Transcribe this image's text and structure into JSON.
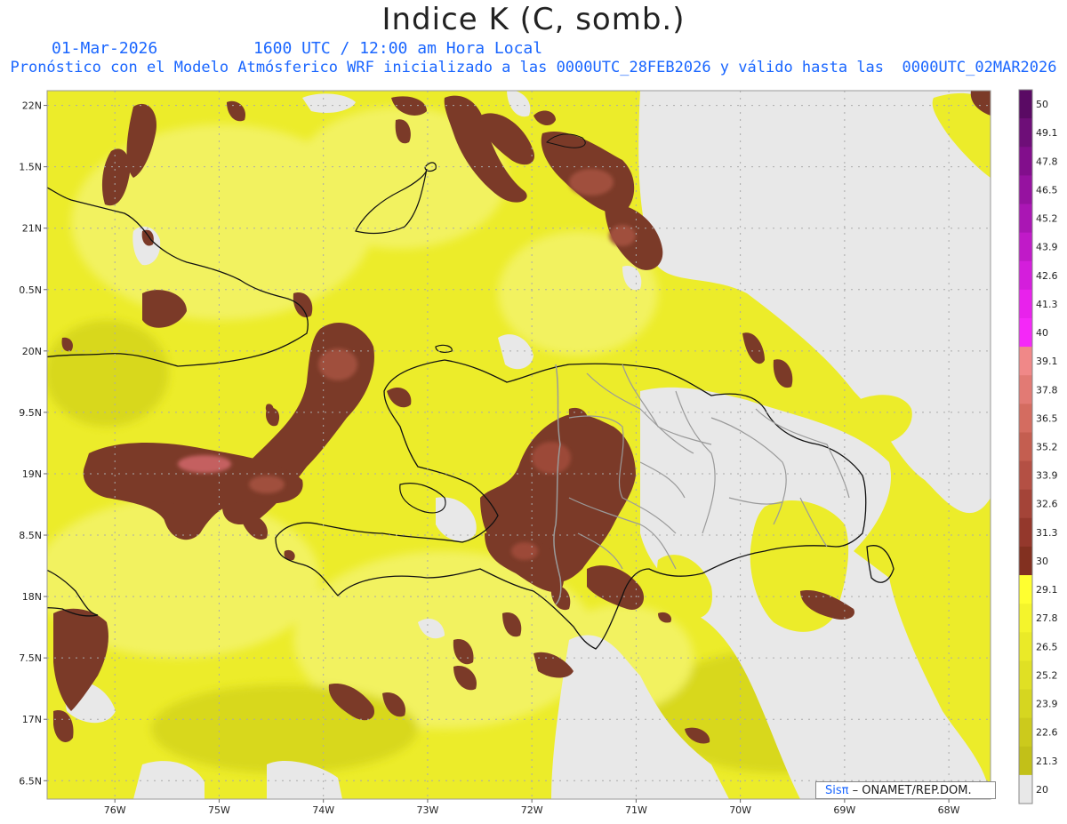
{
  "header": {
    "title": "Indice K (C, somb.)",
    "date": "01-Mar-2026",
    "time": "1600 UTC / 12:00 am Hora Local",
    "model_line": "Pronóstico con el Modelo Atmósferico WRF inicializado a las 0000UTC_28FEB2026 y válido hasta las  0000UTC_02MAR2026"
  },
  "map": {
    "lat_labels": [
      "22N",
      "1.5N",
      "21N",
      "0.5N",
      "20N",
      "9.5N",
      "19N",
      "8.5N",
      "18N",
      "7.5N",
      "17N",
      "6.5N"
    ],
    "lat_values": [
      22,
      21.5,
      21,
      20.5,
      20,
      19.5,
      19,
      18.5,
      18,
      17.5,
      17,
      16.5
    ],
    "lon_labels": [
      "76W",
      "75W",
      "74W",
      "73W",
      "72W",
      "71W",
      "70W",
      "69W",
      "68W"
    ],
    "lon_values": [
      -76,
      -75,
      -74,
      -73,
      -72,
      -71,
      -70,
      -69,
      -68
    ],
    "extent": {
      "lon_min": -76.65,
      "lon_max": -67.6,
      "lat_min": 16.35,
      "lat_max": 22.12
    },
    "colors": {
      "land_gray": "#e8e8e8",
      "yellow_light": "#f0f05a",
      "yellow": "#ecec2a",
      "yellow_dark": "#d4d418",
      "brown": "#7b3a28",
      "brown_light": "#9c4a38",
      "pink": "#d07070",
      "coast": "#111111",
      "border_gray": "#9a9a9a"
    }
  },
  "legend": {
    "labels": [
      "50",
      "49.1",
      "47.8",
      "46.5",
      "45.2",
      "43.9",
      "42.6",
      "41.3",
      "40",
      "39.1",
      "37.8",
      "36.5",
      "35.2",
      "33.9",
      "32.6",
      "31.3",
      "30",
      "29.1",
      "27.8",
      "26.5",
      "25.2",
      "23.9",
      "22.6",
      "21.3",
      "20"
    ],
    "colors": [
      "#5a0a64",
      "#6e0e78",
      "#820e8c",
      "#9612a0",
      "#aa16b4",
      "#c01ac8",
      "#d41edc",
      "#e822ec",
      "#f428f8",
      "#f08888",
      "#e27a74",
      "#d46c60",
      "#c45e50",
      "#b45044",
      "#a44438",
      "#94382c",
      "#823020",
      "#ffff30",
      "#f4f42c",
      "#eaea28",
      "#e0e024",
      "#d6d620",
      "#ccca1c",
      "#c2c018",
      "#e8e8e8"
    ]
  },
  "credit": {
    "brand": "Sisπ",
    "text": " – ONAMET/REP.DOM."
  }
}
